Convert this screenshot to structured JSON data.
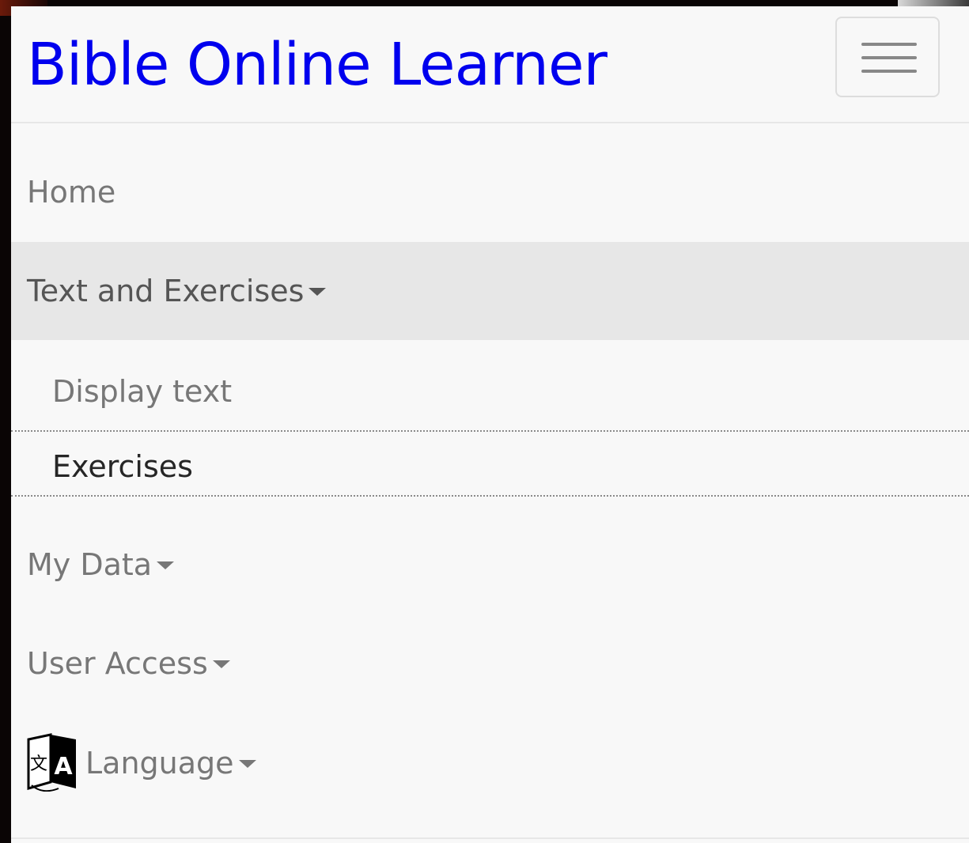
{
  "navbar": {
    "brand": "Bible Online Learner",
    "toggle_icon": "hamburger-menu-icon"
  },
  "menu": {
    "home": "Home",
    "text_and_exercises": {
      "label": "Text and Exercises",
      "expanded": true,
      "items": [
        {
          "label": "Display text"
        },
        {
          "label": "Exercises"
        }
      ]
    },
    "my_data": "My Data",
    "user_access": "User Access",
    "language": {
      "label": "Language",
      "icon": "translate-icon"
    }
  },
  "colors": {
    "brand": "#0000ee",
    "nav_text": "#777777",
    "active_bg": "#e7e7e7",
    "panel_bg": "#f8f8f8"
  }
}
